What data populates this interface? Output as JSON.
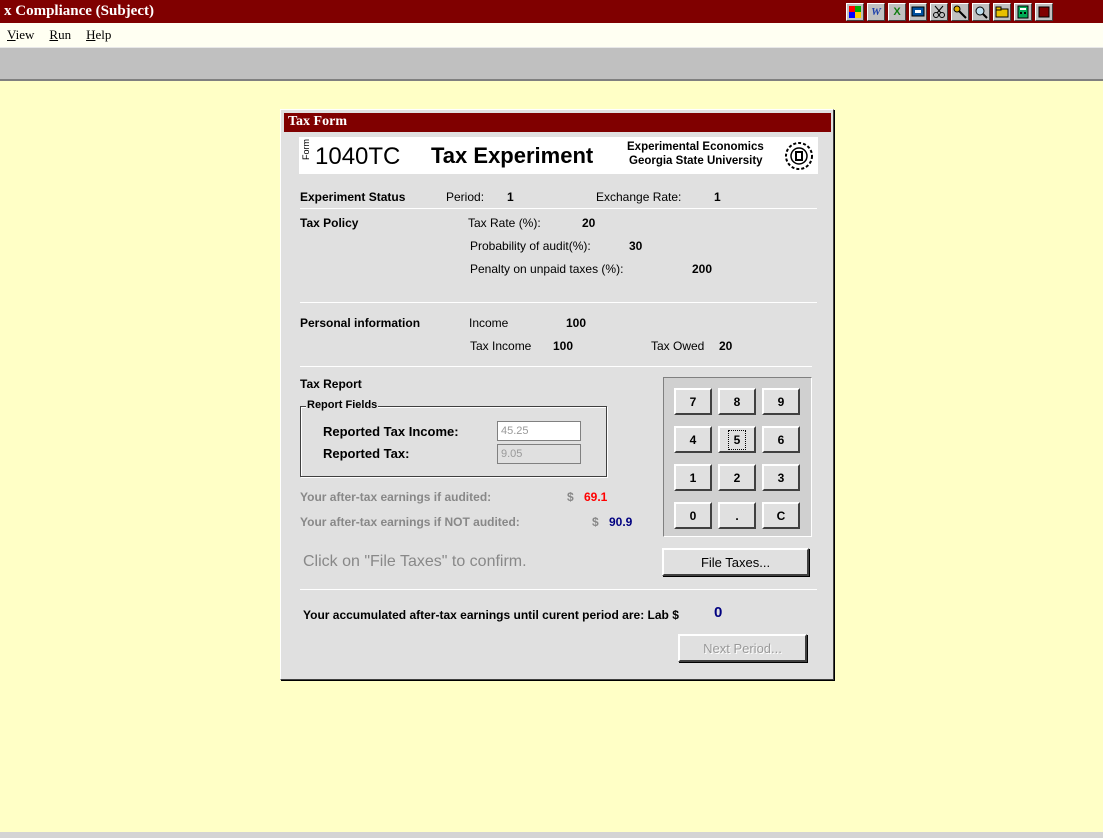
{
  "app": {
    "title": "x Compliance (Subject)",
    "tray_icons": [
      "app-tray-icon",
      "word-icon",
      "excel-icon",
      "screen-icon",
      "scissors-icon",
      "key-icon",
      "magnifier-icon",
      "folder-icon",
      "calculator-icon",
      "extra-tray-icon"
    ]
  },
  "menu": {
    "view": {
      "accel": "V",
      "rest": "iew"
    },
    "run": {
      "accel": "R",
      "rest": "un"
    },
    "help": {
      "accel": "H",
      "rest": "elp"
    }
  },
  "window": {
    "title": "Tax Form",
    "banner": {
      "form_label": "Form",
      "form_number": "1040TC",
      "form_name": "Tax Experiment",
      "org_line1": "Experimental Economics",
      "org_line2": "Georgia State University"
    },
    "status": {
      "heading": "Experiment Status",
      "period_label": "Period:",
      "period_value": "1",
      "exchange_label": "Exchange Rate:",
      "exchange_value": "1"
    },
    "policy": {
      "heading": "Tax Policy",
      "rate_label": "Tax Rate (%):",
      "rate_value": "20",
      "audit_label": "Probability of audit(%):",
      "audit_value": "30",
      "penalty_label": "Penalty on unpaid taxes (%):",
      "penalty_value": "200"
    },
    "personal": {
      "heading": "Personal information",
      "income_label": "Income",
      "income_value": "100",
      "taxincome_label": "Tax Income",
      "taxincome_value": "100",
      "owed_label": "Tax Owed",
      "owed_value": "20"
    },
    "report": {
      "heading": "Tax Report",
      "group_label": "Report Fields",
      "income_label": "Reported Tax Income:",
      "income_value": "45.25",
      "tax_label": "Reported Tax:",
      "tax_value": "9.05"
    },
    "earnings": {
      "audited_label": "Your after-tax earnings if audited:",
      "audited_currency": "$",
      "audited_value": "69.1",
      "not_audited_label": "Your after-tax earnings if NOT audited:",
      "not_audited_currency": "$",
      "not_audited_value": "90.9"
    },
    "keypad": {
      "keys": [
        "7",
        "8",
        "9",
        "4",
        "5",
        "6",
        "1",
        "2",
        "3",
        "0",
        ".",
        "C"
      ],
      "focused": "5"
    },
    "instruction": "Click on \"File Taxes\" to confirm.",
    "file_button": "File Taxes...",
    "accumulated": {
      "label": "Your accumulated after-tax earnings until curent period are:  Lab $",
      "value": "0"
    },
    "next_button": "Next Period..."
  },
  "colors": {
    "titlebar": "#800000",
    "desktop": "#ffffc6",
    "audited_value": "#ff0000",
    "not_audited_value": "#000080"
  }
}
